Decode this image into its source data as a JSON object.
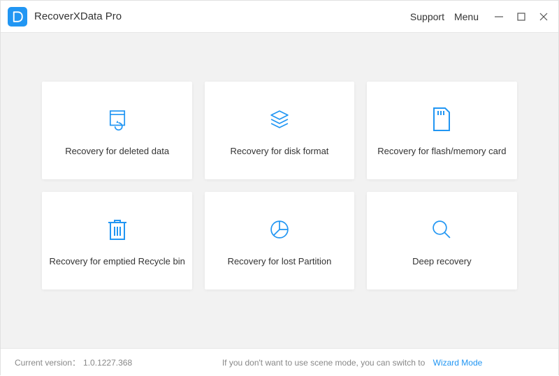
{
  "header": {
    "app_title": "RecoverXData Pro",
    "support_label": "Support",
    "menu_label": "Menu"
  },
  "cards": [
    {
      "label": "Recovery for deleted data",
      "icon": "restore-file-icon"
    },
    {
      "label": "Recovery for disk format",
      "icon": "layers-icon"
    },
    {
      "label": "Recovery for flash/memory card",
      "icon": "sd-card-icon"
    },
    {
      "label": "Recovery for emptied Recycle bin",
      "icon": "trash-icon"
    },
    {
      "label": "Recovery for lost Partition",
      "icon": "partition-icon"
    },
    {
      "label": "Deep recovery",
      "icon": "magnify-icon"
    }
  ],
  "footer": {
    "version_label": "Current version：",
    "version_value": "1.0.1227.368",
    "hint_text": "If you don't want to use scene mode, you can switch to",
    "wizard_link": "Wizard Mode"
  },
  "colors": {
    "accent": "#2196f3"
  }
}
